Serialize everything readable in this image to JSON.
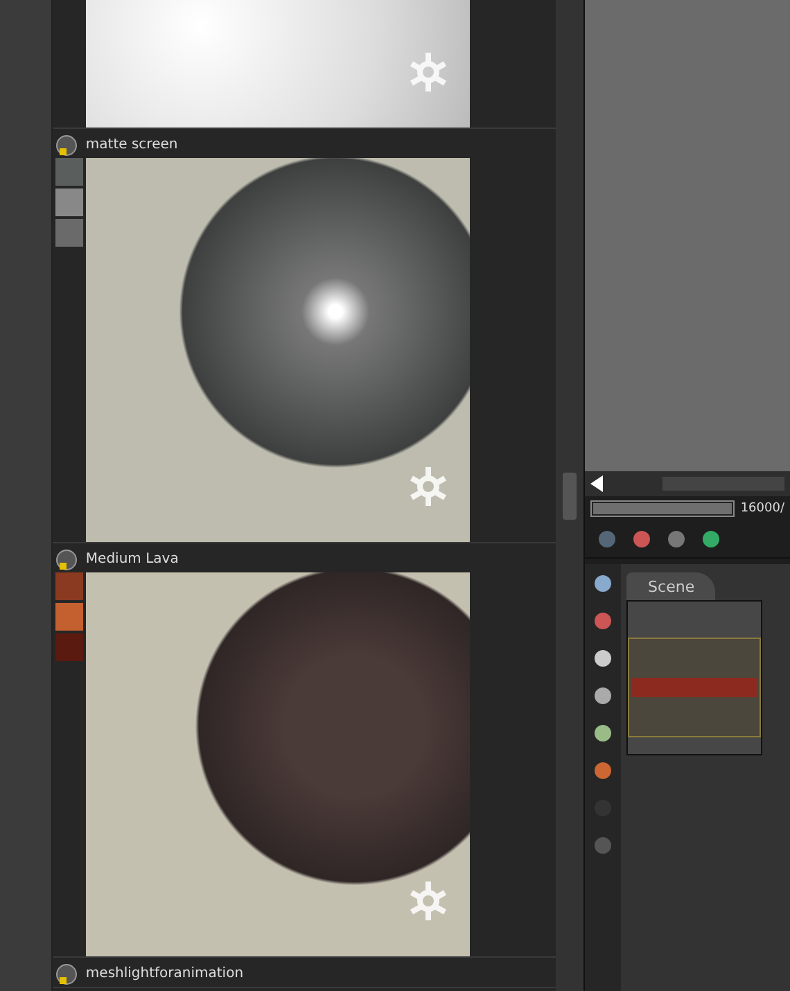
{
  "materials": [
    {
      "kind": "white"
    },
    {
      "name": "matte screen",
      "kind": "grey"
    },
    {
      "name": "Medium Lava",
      "kind": "lava"
    },
    {
      "name": "meshlightforanimation",
      "kind": "collapsed"
    }
  ],
  "render_progress": {
    "level": 1,
    "reading": "16000/"
  },
  "scene_tabs": [
    {
      "label": "Scene",
      "selected": true
    }
  ]
}
